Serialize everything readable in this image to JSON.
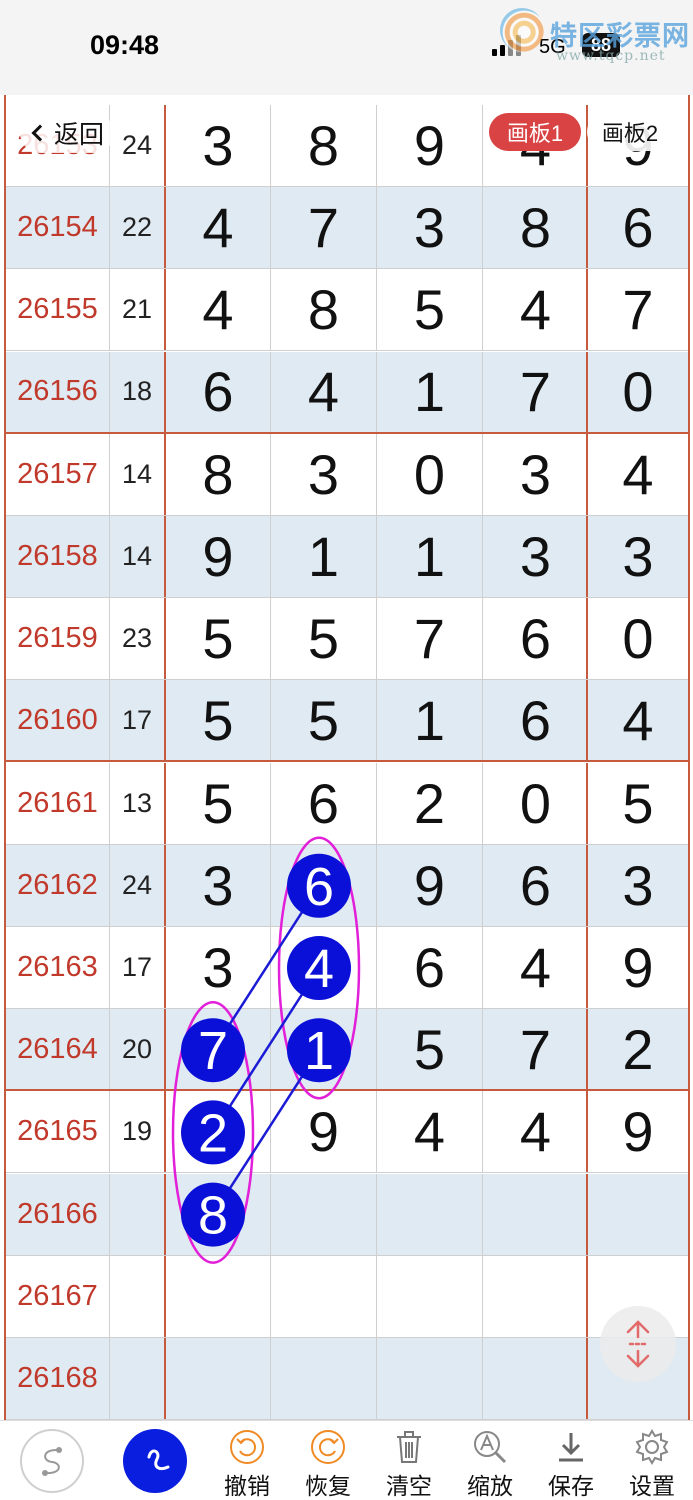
{
  "status_bar": {
    "time": "09:48",
    "network": "5G",
    "battery": "88"
  },
  "watermark": {
    "name": "特区彩票网",
    "url": "www.tqcp.net"
  },
  "nav": {
    "back_label": "返回",
    "boards": [
      "画板1",
      "画板2"
    ],
    "active_board": 0
  },
  "rows": [
    {
      "issue": "26153",
      "sum": "24",
      "digits": [
        "3",
        "8",
        "9",
        "4",
        "9"
      ]
    },
    {
      "issue": "26154",
      "sum": "22",
      "digits": [
        "4",
        "7",
        "3",
        "8",
        "6"
      ]
    },
    {
      "issue": "26155",
      "sum": "21",
      "digits": [
        "4",
        "8",
        "5",
        "4",
        "7"
      ]
    },
    {
      "issue": "26156",
      "sum": "18",
      "digits": [
        "6",
        "4",
        "1",
        "7",
        "0"
      ]
    },
    {
      "issue": "26157",
      "sum": "14",
      "digits": [
        "8",
        "3",
        "0",
        "3",
        "4"
      ]
    },
    {
      "issue": "26158",
      "sum": "14",
      "digits": [
        "9",
        "1",
        "1",
        "3",
        "3"
      ]
    },
    {
      "issue": "26159",
      "sum": "23",
      "digits": [
        "5",
        "5",
        "7",
        "6",
        "0"
      ]
    },
    {
      "issue": "26160",
      "sum": "17",
      "digits": [
        "5",
        "5",
        "1",
        "6",
        "4"
      ]
    },
    {
      "issue": "26161",
      "sum": "13",
      "digits": [
        "5",
        "6",
        "2",
        "0",
        "5"
      ]
    },
    {
      "issue": "26162",
      "sum": "24",
      "digits": [
        "3",
        "6",
        "9",
        "6",
        "3"
      ]
    },
    {
      "issue": "26163",
      "sum": "17",
      "digits": [
        "3",
        "4",
        "6",
        "4",
        "9"
      ]
    },
    {
      "issue": "26164",
      "sum": "20",
      "digits": [
        "7",
        "1",
        "5",
        "7",
        "2"
      ]
    },
    {
      "issue": "26165",
      "sum": "19",
      "digits": [
        "2",
        "9",
        "4",
        "4",
        "9"
      ]
    },
    {
      "issue": "26166",
      "sum": "",
      "digits": [
        "8",
        "",
        "",
        "",
        ""
      ]
    },
    {
      "issue": "26167",
      "sum": "",
      "digits": [
        "",
        "",
        "",
        "",
        ""
      ]
    },
    {
      "issue": "26168",
      "sum": "",
      "digits": [
        "",
        "",
        "",
        "",
        ""
      ]
    }
  ],
  "annotations": {
    "highlights": [
      {
        "row": 11,
        "col": 0,
        "label": "7"
      },
      {
        "row": 12,
        "col": 0,
        "label": "2"
      },
      {
        "row": 13,
        "col": 0,
        "label": "8"
      },
      {
        "row": 9,
        "col": 1,
        "label": "6"
      },
      {
        "row": 10,
        "col": 1,
        "label": "4"
      },
      {
        "row": 11,
        "col": 1,
        "label": "1"
      }
    ],
    "marker_color": "#0a10d8",
    "ellipse_color": "#e21fd9",
    "line_color": "#1b1bd6"
  },
  "toolbar": {
    "items": [
      {
        "name": "undo",
        "label": "撤销",
        "icon": "undo-icon"
      },
      {
        "name": "redo",
        "label": "恢复",
        "icon": "redo-icon"
      },
      {
        "name": "clear",
        "label": "清空",
        "icon": "trash-icon"
      },
      {
        "name": "zoom",
        "label": "缩放",
        "icon": "zoom-icon"
      },
      {
        "name": "save",
        "label": "保存",
        "icon": "download-icon"
      },
      {
        "name": "settings",
        "label": "设置",
        "icon": "gear-icon"
      }
    ]
  },
  "colors": {
    "accent_red": "#c65a3e",
    "issue_text": "#c0392b",
    "alt_row": "#dfeaf2",
    "active_tab": "#d94343"
  }
}
